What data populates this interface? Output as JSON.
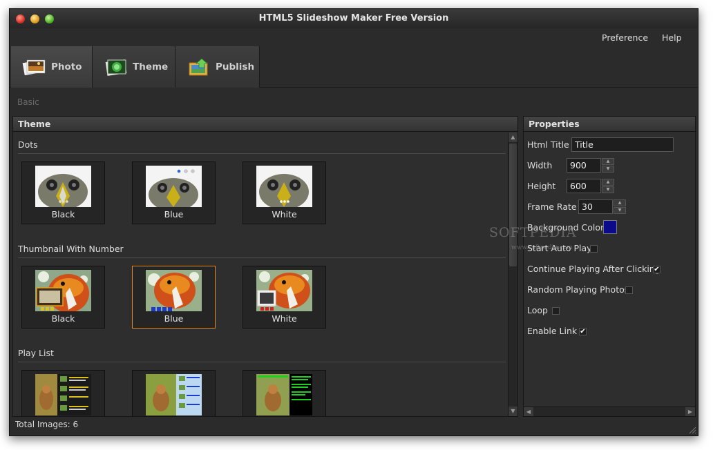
{
  "window": {
    "title": "HTML5 Slideshow Maker Free Version"
  },
  "menu": {
    "preference": "Preference",
    "help": "Help"
  },
  "tabs": [
    {
      "label": "Photo",
      "icon": "photo-stack-icon"
    },
    {
      "label": "Theme",
      "icon": "theme-icon"
    },
    {
      "label": "Publish",
      "icon": "publish-icon"
    }
  ],
  "basic_label": "Basic",
  "theme_panel": {
    "header": "Theme",
    "sections": [
      {
        "title": "Dots",
        "items": [
          "Black",
          "Blue",
          "White"
        ]
      },
      {
        "title": "Thumbnail With Number",
        "items": [
          "Black",
          "Blue",
          "White"
        ],
        "selected": "Blue"
      },
      {
        "title": "Play List",
        "items": [
          "",
          "",
          ""
        ]
      }
    ]
  },
  "status": "Total Images: 6",
  "properties": {
    "header": "Properties",
    "html_title_label": "Html Title",
    "html_title_value": "Title",
    "width_label": "Width",
    "width_value": "900",
    "height_label": "Height",
    "height_value": "600",
    "frame_rate_label": "Frame Rate",
    "frame_rate_value": "30",
    "bg_color_label": "Background Color",
    "bg_color": "#0a0a8a",
    "start_auto_play_label": "Start Auto Play",
    "start_auto_play": false,
    "continue_playing_label": "Continue Playing After Clicking",
    "continue_playing": true,
    "random_playing_label": "Random Playing Photos",
    "random_playing": false,
    "loop_label": "Loop",
    "loop": false,
    "enable_link_label": "Enable Link",
    "enable_link": true
  },
  "watermark": {
    "brand": "SOFTPEDIA",
    "url": "www.softpedia.com"
  },
  "colors": {
    "background": "#2b2b2b",
    "selected_border": "#e08a2a"
  }
}
